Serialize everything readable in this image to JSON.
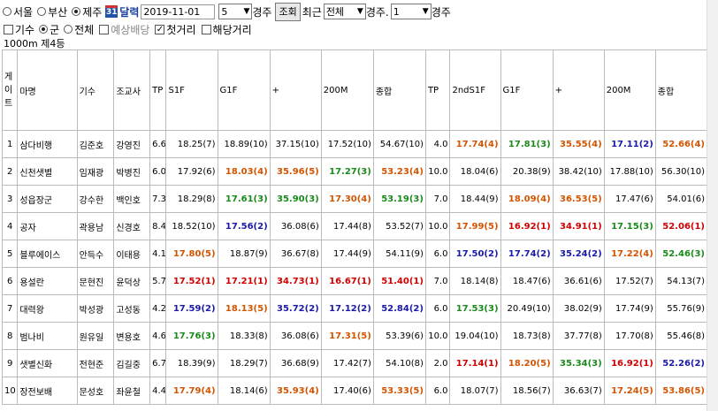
{
  "filters": {
    "venues": [
      "서울",
      "부산",
      "제주"
    ],
    "selected_venue": "제주",
    "calendar_label": "달력",
    "date_value": "2019-11-01",
    "race_no": "5",
    "race_suffix": "경주",
    "query_label": "조회",
    "recent_label": "최근",
    "recent_value": "전체",
    "race_prefix2": "경주.",
    "race_no2": "1",
    "race_suffix2": "경주"
  },
  "options": {
    "jockey_label": "기수",
    "group_label": "군",
    "all_label": "전체",
    "odds_label": "예상배당",
    "first_dist_label": "첫거리",
    "same_dist_label": "해당거리"
  },
  "race_info": "1000m  제4등",
  "table": {
    "headers": [
      "게\n이\n트",
      "마명",
      "기수",
      "조교사",
      "TP",
      "S1F",
      "G1F",
      "+",
      "200M",
      "종합",
      "TP",
      "2ndS1F",
      "G1F",
      "+",
      "200M",
      "종합"
    ],
    "rows": [
      {
        "gate": "1",
        "horse": "삼다비행",
        "jockey": "김준호",
        "trainer": "강영진",
        "tp": "6.6",
        "s1f": {
          "v": "18.25(7)",
          "c": ""
        },
        "g1f": {
          "v": "18.89(10)",
          "c": ""
        },
        "plus": {
          "v": "37.15(10)",
          "c": ""
        },
        "m200": {
          "v": "17.52(10)",
          "c": ""
        },
        "total": {
          "v": "54.67(10)",
          "c": ""
        },
        "tp2": "4.0",
        "s1f2": {
          "v": "17.74(4)",
          "c": "o"
        },
        "g1f2": {
          "v": "17.81(3)",
          "c": "g"
        },
        "plus2": {
          "v": "35.55(4)",
          "c": "o"
        },
        "m2002": {
          "v": "17.11(2)",
          "c": "b"
        },
        "total2": {
          "v": "52.66(4)",
          "c": "o"
        }
      },
      {
        "gate": "2",
        "horse": "신천샛별",
        "jockey": "임재광",
        "trainer": "박병진",
        "tp": "6.0",
        "s1f": {
          "v": "17.92(6)",
          "c": ""
        },
        "g1f": {
          "v": "18.03(4)",
          "c": "o"
        },
        "plus": {
          "v": "35.96(5)",
          "c": "o"
        },
        "m200": {
          "v": "17.27(3)",
          "c": "g"
        },
        "total": {
          "v": "53.23(4)",
          "c": "o"
        },
        "tp2": "10.0",
        "s1f2": {
          "v": "18.04(6)",
          "c": ""
        },
        "g1f2": {
          "v": "20.38(9)",
          "c": ""
        },
        "plus2": {
          "v": "38.42(10)",
          "c": ""
        },
        "m2002": {
          "v": "17.88(10)",
          "c": ""
        },
        "total2": {
          "v": "56.30(10)",
          "c": ""
        }
      },
      {
        "gate": "3",
        "horse": "성읍장군",
        "jockey": "강수한",
        "trainer": "백인호",
        "tp": "7.3",
        "s1f": {
          "v": "18.29(8)",
          "c": ""
        },
        "g1f": {
          "v": "17.61(3)",
          "c": "g"
        },
        "plus": {
          "v": "35.90(3)",
          "c": "g"
        },
        "m200": {
          "v": "17.30(4)",
          "c": "o"
        },
        "total": {
          "v": "53.19(3)",
          "c": "g"
        },
        "tp2": "7.0",
        "s1f2": {
          "v": "18.44(9)",
          "c": ""
        },
        "g1f2": {
          "v": "18.09(4)",
          "c": "o"
        },
        "plus2": {
          "v": "36.53(5)",
          "c": "o"
        },
        "m2002": {
          "v": "17.47(6)",
          "c": ""
        },
        "total2": {
          "v": "54.01(6)",
          "c": ""
        }
      },
      {
        "gate": "4",
        "horse": "공자",
        "jockey": "곽용남",
        "trainer": "신경호",
        "tp": "8.4",
        "s1f": {
          "v": "18.52(10)",
          "c": ""
        },
        "g1f": {
          "v": "17.56(2)",
          "c": "b"
        },
        "plus": {
          "v": "36.08(6)",
          "c": ""
        },
        "m200": {
          "v": "17.44(8)",
          "c": ""
        },
        "total": {
          "v": "53.52(7)",
          "c": ""
        },
        "tp2": "10.0",
        "s1f2": {
          "v": "17.99(5)",
          "c": "o"
        },
        "g1f2": {
          "v": "16.92(1)",
          "c": "r"
        },
        "plus2": {
          "v": "34.91(1)",
          "c": "r"
        },
        "m2002": {
          "v": "17.15(3)",
          "c": "g"
        },
        "total2": {
          "v": "52.06(1)",
          "c": "r"
        }
      },
      {
        "gate": "5",
        "horse": "블루에이스",
        "jockey": "안득수",
        "trainer": "이태용",
        "tp": "4.1",
        "s1f": {
          "v": "17.80(5)",
          "c": "o"
        },
        "g1f": {
          "v": "18.87(9)",
          "c": ""
        },
        "plus": {
          "v": "36.67(8)",
          "c": ""
        },
        "m200": {
          "v": "17.44(9)",
          "c": ""
        },
        "total": {
          "v": "54.11(9)",
          "c": ""
        },
        "tp2": "6.0",
        "s1f2": {
          "v": "17.50(2)",
          "c": "b"
        },
        "g1f2": {
          "v": "17.74(2)",
          "c": "b"
        },
        "plus2": {
          "v": "35.24(2)",
          "c": "b"
        },
        "m2002": {
          "v": "17.22(4)",
          "c": "o"
        },
        "total2": {
          "v": "52.46(3)",
          "c": "g"
        }
      },
      {
        "gate": "6",
        "horse": "용설란",
        "jockey": "문현진",
        "trainer": "윤덕상",
        "tp": "5.7",
        "s1f": {
          "v": "17.52(1)",
          "c": "r"
        },
        "g1f": {
          "v": "17.21(1)",
          "c": "r"
        },
        "plus": {
          "v": "34.73(1)",
          "c": "r"
        },
        "m200": {
          "v": "16.67(1)",
          "c": "r"
        },
        "total": {
          "v": "51.40(1)",
          "c": "r"
        },
        "tp2": "7.0",
        "s1f2": {
          "v": "18.14(8)",
          "c": ""
        },
        "g1f2": {
          "v": "18.47(6)",
          "c": ""
        },
        "plus2": {
          "v": "36.61(6)",
          "c": ""
        },
        "m2002": {
          "v": "17.52(7)",
          "c": ""
        },
        "total2": {
          "v": "54.13(7)",
          "c": ""
        }
      },
      {
        "gate": "7",
        "horse": "대력왕",
        "jockey": "박성광",
        "trainer": "고성동",
        "tp": "4.2",
        "s1f": {
          "v": "17.59(2)",
          "c": "b"
        },
        "g1f": {
          "v": "18.13(5)",
          "c": "o"
        },
        "plus": {
          "v": "35.72(2)",
          "c": "b"
        },
        "m200": {
          "v": "17.12(2)",
          "c": "b"
        },
        "total": {
          "v": "52.84(2)",
          "c": "b"
        },
        "tp2": "6.0",
        "s1f2": {
          "v": "17.53(3)",
          "c": "g"
        },
        "g1f2": {
          "v": "20.49(10)",
          "c": ""
        },
        "plus2": {
          "v": "38.02(9)",
          "c": ""
        },
        "m2002": {
          "v": "17.74(9)",
          "c": ""
        },
        "total2": {
          "v": "55.76(9)",
          "c": ""
        }
      },
      {
        "gate": "8",
        "horse": "범나비",
        "jockey": "원유일",
        "trainer": "변용호",
        "tp": "4.6",
        "s1f": {
          "v": "17.76(3)",
          "c": "g"
        },
        "g1f": {
          "v": "18.33(8)",
          "c": ""
        },
        "plus": {
          "v": "36.08(6)",
          "c": ""
        },
        "m200": {
          "v": "17.31(5)",
          "c": "o"
        },
        "total": {
          "v": "53.39(6)",
          "c": ""
        },
        "tp2": "10.0",
        "s1f2": {
          "v": "19.04(10)",
          "c": ""
        },
        "g1f2": {
          "v": "18.73(8)",
          "c": ""
        },
        "plus2": {
          "v": "37.77(8)",
          "c": ""
        },
        "m2002": {
          "v": "17.70(8)",
          "c": ""
        },
        "total2": {
          "v": "55.46(8)",
          "c": ""
        }
      },
      {
        "gate": "9",
        "horse": "샛별신화",
        "jockey": "전현준",
        "trainer": "김길중",
        "tp": "6.7",
        "s1f": {
          "v": "18.39(9)",
          "c": ""
        },
        "g1f": {
          "v": "18.29(7)",
          "c": ""
        },
        "plus": {
          "v": "36.68(9)",
          "c": ""
        },
        "m200": {
          "v": "17.42(7)",
          "c": ""
        },
        "total": {
          "v": "54.10(8)",
          "c": ""
        },
        "tp2": "2.0",
        "s1f2": {
          "v": "17.14(1)",
          "c": "r"
        },
        "g1f2": {
          "v": "18.20(5)",
          "c": "o"
        },
        "plus2": {
          "v": "35.34(3)",
          "c": "g"
        },
        "m2002": {
          "v": "16.92(1)",
          "c": "r"
        },
        "total2": {
          "v": "52.26(2)",
          "c": "b"
        }
      },
      {
        "gate": "10",
        "horse": "장전보배",
        "jockey": "문성호",
        "trainer": "좌윤철",
        "tp": "4.4",
        "s1f": {
          "v": "17.79(4)",
          "c": "o"
        },
        "g1f": {
          "v": "18.14(6)",
          "c": ""
        },
        "plus": {
          "v": "35.93(4)",
          "c": "o"
        },
        "m200": {
          "v": "17.40(6)",
          "c": ""
        },
        "total": {
          "v": "53.33(5)",
          "c": "o"
        },
        "tp2": "6.0",
        "s1f2": {
          "v": "18.07(7)",
          "c": ""
        },
        "g1f2": {
          "v": "18.56(7)",
          "c": ""
        },
        "plus2": {
          "v": "36.63(7)",
          "c": ""
        },
        "m2002": {
          "v": "17.24(5)",
          "c": "o"
        },
        "total2": {
          "v": "53.86(5)",
          "c": "o"
        }
      }
    ]
  },
  "colors": {
    "rank1": "#d10000",
    "rank2": "#1a1aaa",
    "rank3": "#1a8a1a",
    "rank45": "#d35400"
  }
}
